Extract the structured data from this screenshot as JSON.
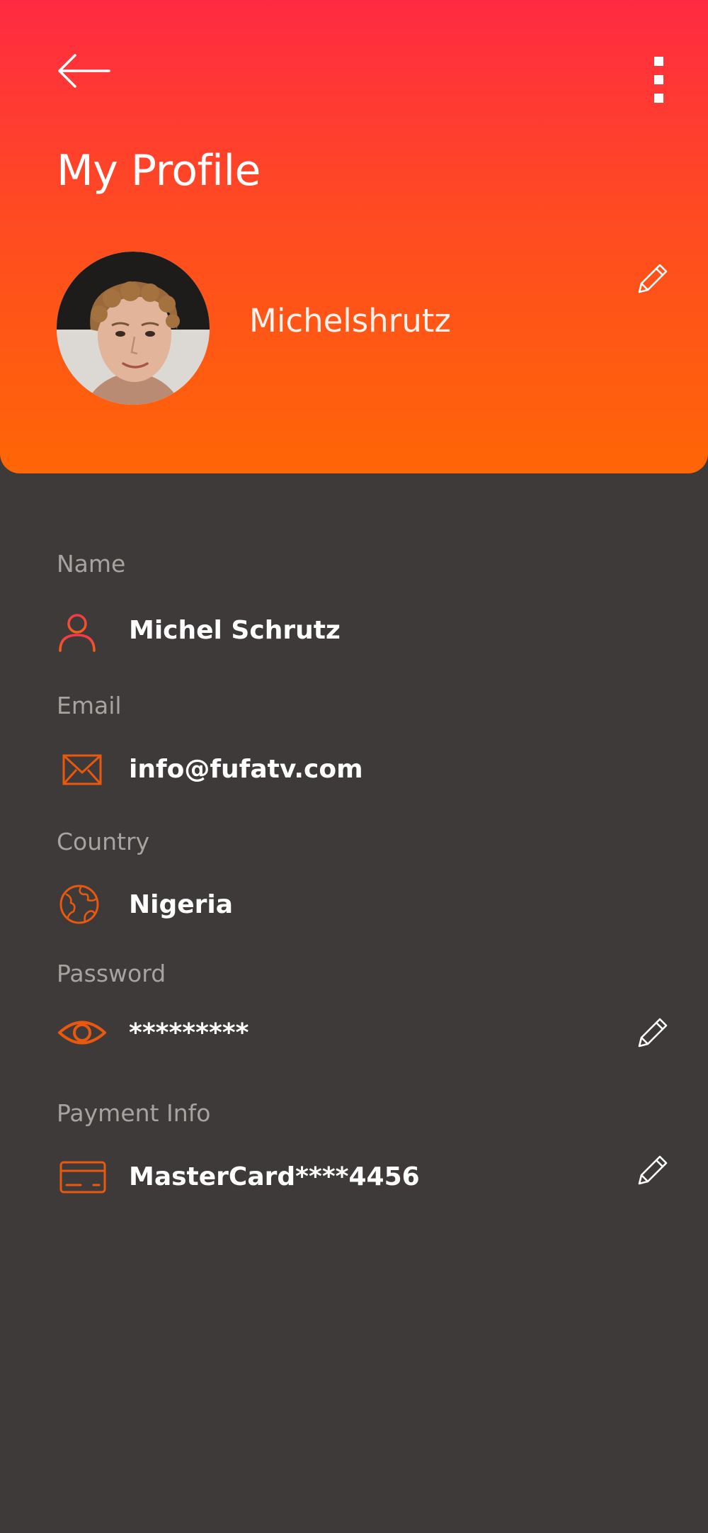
{
  "header": {
    "title": "My Profile",
    "back_icon": "arrow-left-icon",
    "menu_icon": "more-vertical-icon"
  },
  "profile": {
    "username": "Michelshrutz",
    "avatar_icon": "avatar-photo"
  },
  "fields": [
    {
      "label": "Name",
      "value": "Michel Schrutz",
      "icon": "user-icon",
      "editable": false
    },
    {
      "label": "Email",
      "value": "info@fufatv.com",
      "icon": "mail-icon",
      "editable": false
    },
    {
      "label": "Country",
      "value": "Nigeria",
      "icon": "globe-icon",
      "editable": false
    },
    {
      "label": "Password",
      "value": "*********",
      "icon": "eye-icon",
      "editable": true
    },
    {
      "label": "Payment Info",
      "value": "MasterCard****4456",
      "icon": "credit-card-icon",
      "editable": true
    }
  ],
  "colors": {
    "gradient_top": "#ff2a42",
    "gradient_bottom": "#ff6606",
    "background": "#3d3a39",
    "label": "#a7a3a1",
    "value": "#ffffff",
    "icon_accent": "#e8580f"
  }
}
